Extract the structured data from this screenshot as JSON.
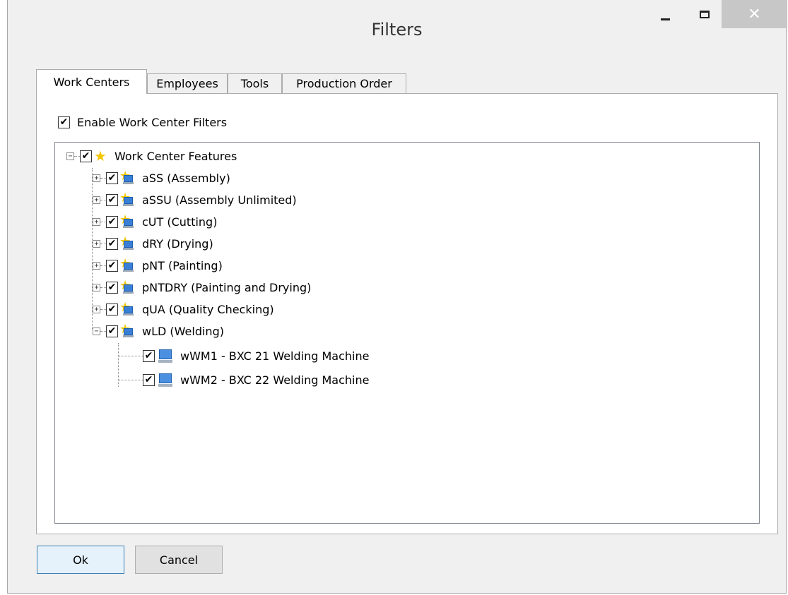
{
  "window": {
    "title": "Filters",
    "close_glyph": "✕"
  },
  "tabs": [
    {
      "label": "Work Centers",
      "active": true
    },
    {
      "label": "Employees",
      "active": false
    },
    {
      "label": "Tools",
      "active": false
    },
    {
      "label": "Production Order",
      "active": false
    }
  ],
  "enable_filters": {
    "label": "Enable Work Center Filters",
    "checked": true
  },
  "tree": {
    "root": {
      "label": "Work Center Features",
      "checked": true,
      "expanded": true,
      "icon": "star-icon"
    },
    "work_centers": [
      {
        "label": "aSS (Assembly)",
        "checked": true,
        "expanded": false,
        "icon": "work-center-icon"
      },
      {
        "label": "aSSU (Assembly Unlimited)",
        "checked": true,
        "expanded": false,
        "icon": "work-center-icon"
      },
      {
        "label": "cUT (Cutting)",
        "checked": true,
        "expanded": false,
        "icon": "work-center-icon"
      },
      {
        "label": "dRY (Drying)",
        "checked": true,
        "expanded": false,
        "icon": "work-center-icon"
      },
      {
        "label": "pNT (Painting)",
        "checked": true,
        "expanded": false,
        "icon": "work-center-icon"
      },
      {
        "label": "pNTDRY (Painting and Drying)",
        "checked": true,
        "expanded": false,
        "icon": "work-center-icon"
      },
      {
        "label": "qUA (Quality Checking)",
        "checked": true,
        "expanded": false,
        "icon": "work-center-icon"
      },
      {
        "label": "wLD (Welding)",
        "checked": true,
        "expanded": true,
        "icon": "work-center-icon"
      }
    ],
    "machines": [
      {
        "label": "wWM1 - BXC 21 Welding Machine",
        "checked": true,
        "icon": "machine-icon"
      },
      {
        "label": "wWM2 - BXC 22 Welding Machine",
        "checked": true,
        "icon": "machine-icon"
      }
    ]
  },
  "buttons": {
    "ok": "Ok",
    "cancel": "Cancel"
  },
  "glyphs": {
    "check": "✔",
    "collapse": "−",
    "expand": "+",
    "star": "★"
  }
}
